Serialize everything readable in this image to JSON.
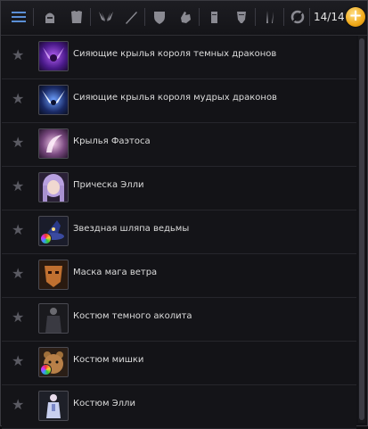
{
  "toolbar": {
    "icons": [
      "menu-icon",
      "helmet-icon",
      "armor-icon",
      "wings-icon",
      "weapon-icon",
      "shield-icon",
      "glove-icon",
      "boots-icon",
      "ring-icon",
      "blades-icon",
      "accessory-icon"
    ],
    "count": "14/14",
    "add": "+"
  },
  "items": [
    {
      "label": "Сияющие крылья короля темных драконов",
      "thumb": "dark-dragon-wings-thumb"
    },
    {
      "label": "Сияющие крылья короля мудрых драконов",
      "thumb": "wise-dragon-wings-thumb"
    },
    {
      "label": "Крылья Фаэтоса",
      "thumb": "phaetos-wings-thumb"
    },
    {
      "label": "Прическа Элли",
      "thumb": "elly-hairstyle-thumb"
    },
    {
      "label": "Звездная шляпа ведьмы",
      "thumb": "witch-hat-thumb"
    },
    {
      "label": "Маска мага ветра",
      "thumb": "wind-mage-mask-thumb"
    },
    {
      "label": "Костюм темного аколита",
      "thumb": "dark-acolyte-costume-thumb"
    },
    {
      "label": "Костюм мишки",
      "thumb": "bear-costume-thumb"
    },
    {
      "label": "Костюм Элли",
      "thumb": "elly-costume-thumb"
    }
  ],
  "colors": {
    "accent": "#f0a818",
    "star": "#5a5a62"
  }
}
